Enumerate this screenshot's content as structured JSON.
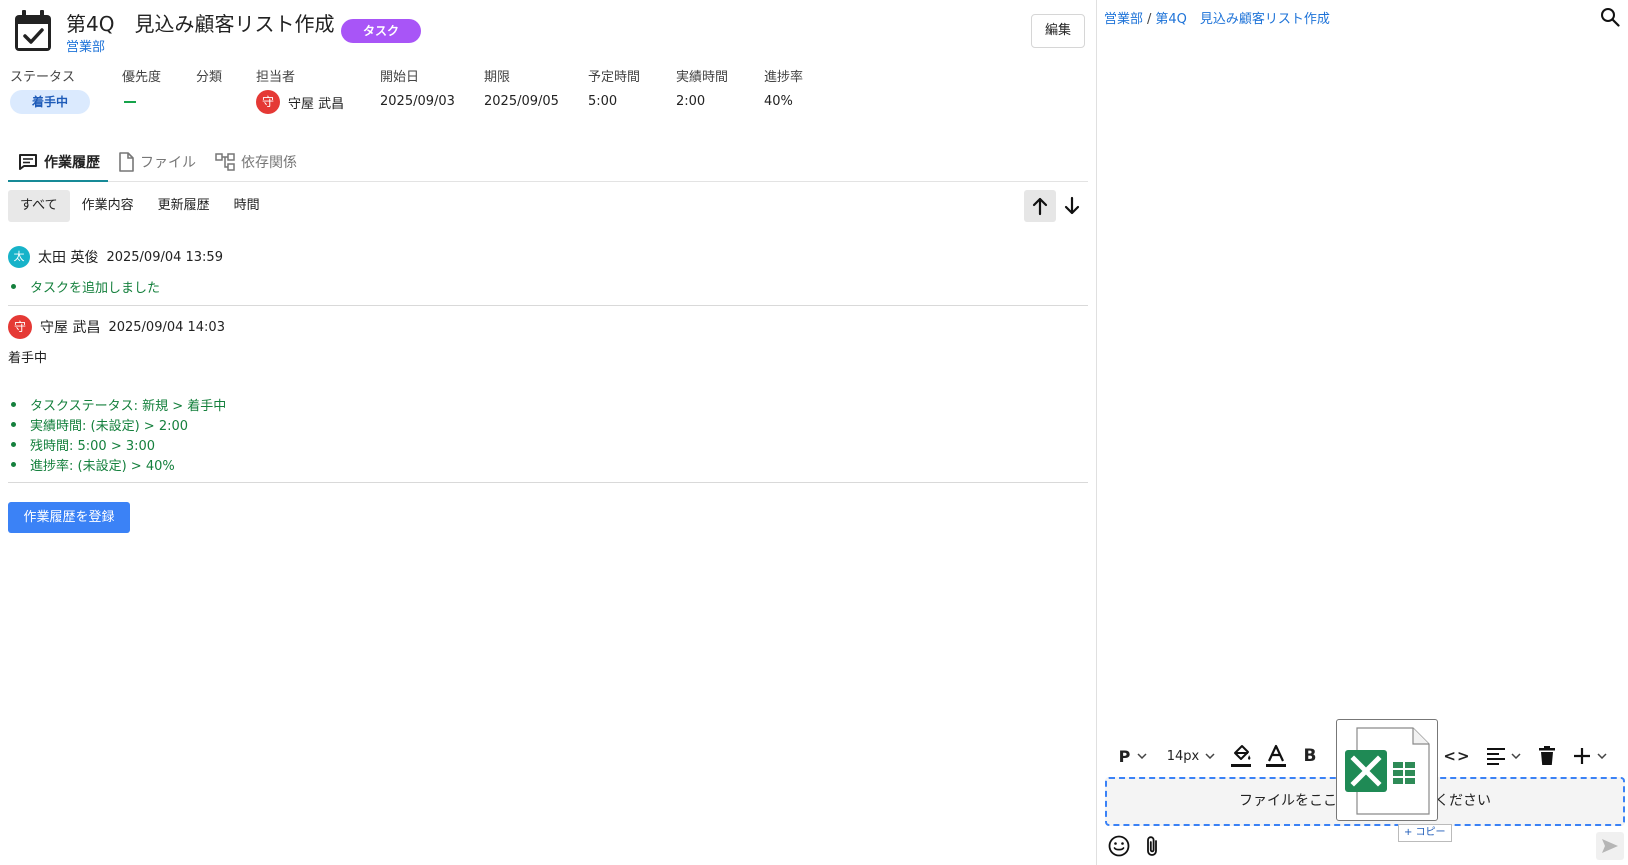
{
  "header": {
    "title": "第4Q　見込み顧客リスト作成",
    "department": "営業部",
    "type_badge": "タスク",
    "edit_label": "編集"
  },
  "meta": {
    "status": {
      "label": "ステータス",
      "value": "着手中"
    },
    "priority": {
      "label": "優先度",
      "value": "—"
    },
    "category": {
      "label": "分類",
      "value": ""
    },
    "assignee": {
      "label": "担当者",
      "avatar": "守",
      "name": "守屋 武昌"
    },
    "start_date": {
      "label": "開始日",
      "value": "2025/09/03"
    },
    "due_date": {
      "label": "期限",
      "value": "2025/09/05"
    },
    "planned_time": {
      "label": "予定時間",
      "value": "5:00"
    },
    "actual_time": {
      "label": "実績時間",
      "value": "2:00"
    },
    "progress": {
      "label": "進捗率",
      "value": "40%"
    }
  },
  "tabs": [
    {
      "label": "作業履歴",
      "icon": "comment-icon",
      "active": true
    },
    {
      "label": "ファイル",
      "icon": "file-icon",
      "active": false
    },
    {
      "label": "依存関係",
      "icon": "dependency-icon",
      "active": false
    }
  ],
  "filters": [
    {
      "label": "すべて",
      "active": true
    },
    {
      "label": "作業内容",
      "active": false
    },
    {
      "label": "更新履歴",
      "active": false
    },
    {
      "label": "時間",
      "active": false
    }
  ],
  "history": [
    {
      "avatar": "太",
      "avatar_color": "#17b3c9",
      "user": "太田 英俊",
      "timestamp": "2025/09/04 13:59",
      "body": "",
      "changes": [
        "タスクを追加しました"
      ]
    },
    {
      "avatar": "守",
      "avatar_color": "#e53935",
      "user": "守屋 武昌",
      "timestamp": "2025/09/04 14:03",
      "body": "着手中",
      "changes": [
        "タスクステータス: 新規 > 着手中",
        "実績時間: (未設定) > 2:00",
        "残時間: 5:00 > 3:00",
        "進捗率: (未設定) > 40%"
      ]
    }
  ],
  "register_label": "作業履歴を登録",
  "right_panel": {
    "breadcrumb": [
      "営業部",
      "第4Q　見込み顧客リスト作成"
    ],
    "breadcrumb_sep": "/",
    "toolbar": {
      "paragraph": "P",
      "font_size": "14px",
      "bold": "B",
      "code": "<>"
    },
    "dropzone_text": "ファイルをここ　　　　　　　ください",
    "copy_tip": "+ コピー"
  },
  "colors": {
    "accent_teal": "#178a97",
    "link_blue": "#1e73d8",
    "task_purple": "#a855f7",
    "primary_blue": "#3b82f6",
    "change_green": "#15803d"
  }
}
